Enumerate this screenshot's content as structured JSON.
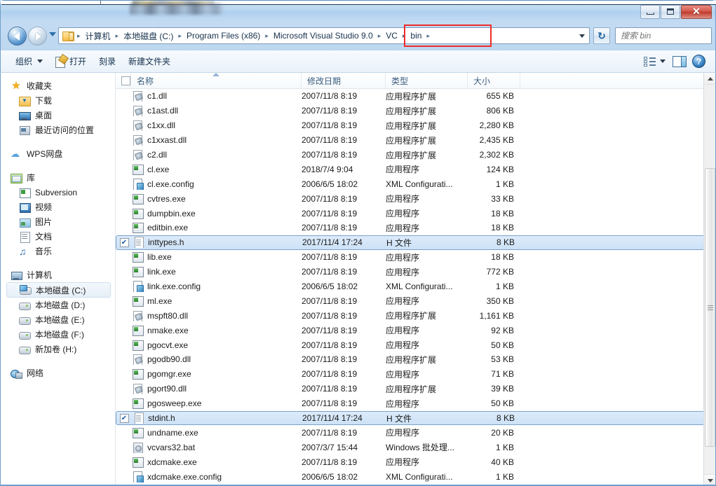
{
  "window": {
    "title_obscured": "",
    "controls": {
      "minimize": "最小化",
      "maximize": "最大化",
      "close": "✕"
    }
  },
  "navigation": {
    "back": "后退",
    "forward": "前进",
    "recent_dropdown": "最近浏览的位置",
    "refresh": "↻",
    "breadcrumbs": [
      {
        "label": "计算机",
        "highlighted": false
      },
      {
        "label": "本地磁盘 (C:)",
        "highlighted": false
      },
      {
        "label": "Program Files (x86)",
        "highlighted": false
      },
      {
        "label": "Microsoft Visual Studio 9.0",
        "highlighted": false
      },
      {
        "label": "VC",
        "highlighted": true
      },
      {
        "label": "bin",
        "highlighted": true
      }
    ],
    "separator": "▸",
    "highlight_color": "#ef2b2b"
  },
  "search": {
    "placeholder": "搜索 bin",
    "value": "",
    "icon": "search-icon"
  },
  "toolbar": {
    "organize_label": "组织",
    "open_label": "打开",
    "burn_label": "刻录",
    "new_folder_label": "新建文件夹",
    "view_options": "更改您的视图",
    "preview_pane": "显示预览窗格",
    "help": "?"
  },
  "sidebar": {
    "groups": [
      {
        "header": {
          "label": "收藏夹",
          "icon": "star-icon"
        },
        "items": [
          {
            "label": "下载",
            "icon": "downloads-folder-icon",
            "selected": false
          },
          {
            "label": "桌面",
            "icon": "desktop-icon",
            "selected": false
          },
          {
            "label": "最近访问的位置",
            "icon": "recent-places-icon",
            "selected": false
          }
        ]
      },
      {
        "header": {
          "label": "WPS网盘",
          "icon": "cloud-icon"
        },
        "items": []
      },
      {
        "header": {
          "label": "库",
          "icon": "library-icon"
        },
        "items": [
          {
            "label": "Subversion",
            "icon": "subversion-icon",
            "selected": false
          },
          {
            "label": "视频",
            "icon": "video-icon",
            "selected": false
          },
          {
            "label": "图片",
            "icon": "picture-icon",
            "selected": false
          },
          {
            "label": "文档",
            "icon": "document-icon",
            "selected": false
          },
          {
            "label": "音乐",
            "icon": "music-icon",
            "selected": false
          }
        ]
      },
      {
        "header": {
          "label": "计算机",
          "icon": "computer-icon"
        },
        "items": [
          {
            "label": "本地磁盘 (C:)",
            "icon": "system-drive-icon",
            "selected": true
          },
          {
            "label": "本地磁盘 (D:)",
            "icon": "drive-icon",
            "selected": false
          },
          {
            "label": "本地磁盘 (E:)",
            "icon": "drive-icon",
            "selected": false
          },
          {
            "label": "本地磁盘 (F:)",
            "icon": "drive-icon",
            "selected": false
          },
          {
            "label": "新加卷 (H:)",
            "icon": "drive-icon",
            "selected": false
          }
        ]
      },
      {
        "header": {
          "label": "网络",
          "icon": "network-icon"
        },
        "items": []
      }
    ]
  },
  "filelist": {
    "columns": [
      {
        "key": "name",
        "label": "名称",
        "sorted": true
      },
      {
        "key": "date",
        "label": "修改日期",
        "sorted": false
      },
      {
        "key": "type",
        "label": "类型",
        "sorted": false
      },
      {
        "key": "size",
        "label": "大小",
        "sorted": false
      }
    ],
    "rows": [
      {
        "name": "c1.dll",
        "date": "2007/11/8 8:19",
        "type": "应用程序扩展",
        "size": "655 KB",
        "icon": "dll-file-icon",
        "selected": false,
        "checked": false
      },
      {
        "name": "c1ast.dll",
        "date": "2007/11/8 8:19",
        "type": "应用程序扩展",
        "size": "806 KB",
        "icon": "dll-file-icon",
        "selected": false,
        "checked": false
      },
      {
        "name": "c1xx.dll",
        "date": "2007/11/8 8:19",
        "type": "应用程序扩展",
        "size": "2,280 KB",
        "icon": "dll-file-icon",
        "selected": false,
        "checked": false
      },
      {
        "name": "c1xxast.dll",
        "date": "2007/11/8 8:19",
        "type": "应用程序扩展",
        "size": "2,435 KB",
        "icon": "dll-file-icon",
        "selected": false,
        "checked": false
      },
      {
        "name": "c2.dll",
        "date": "2007/11/8 8:19",
        "type": "应用程序扩展",
        "size": "2,302 KB",
        "icon": "dll-file-icon",
        "selected": false,
        "checked": false
      },
      {
        "name": "cl.exe",
        "date": "2018/7/4 9:04",
        "type": "应用程序",
        "size": "124 KB",
        "icon": "exe-file-icon",
        "selected": false,
        "checked": false
      },
      {
        "name": "cl.exe.config",
        "date": "2006/6/5 18:02",
        "type": "XML Configurati...",
        "size": "1 KB",
        "icon": "xml-file-icon",
        "selected": false,
        "checked": false
      },
      {
        "name": "cvtres.exe",
        "date": "2007/11/8 8:19",
        "type": "应用程序",
        "size": "33 KB",
        "icon": "exe-file-icon",
        "selected": false,
        "checked": false
      },
      {
        "name": "dumpbin.exe",
        "date": "2007/11/8 8:19",
        "type": "应用程序",
        "size": "18 KB",
        "icon": "exe-file-icon",
        "selected": false,
        "checked": false
      },
      {
        "name": "editbin.exe",
        "date": "2007/11/8 8:19",
        "type": "应用程序",
        "size": "18 KB",
        "icon": "exe-file-icon",
        "selected": false,
        "checked": false
      },
      {
        "name": "inttypes.h",
        "date": "2017/11/4 17:24",
        "type": "H 文件",
        "size": "8 KB",
        "icon": "h-file-icon",
        "selected": true,
        "checked": true
      },
      {
        "name": "lib.exe",
        "date": "2007/11/8 8:19",
        "type": "应用程序",
        "size": "18 KB",
        "icon": "exe-file-icon",
        "selected": false,
        "checked": false
      },
      {
        "name": "link.exe",
        "date": "2007/11/8 8:19",
        "type": "应用程序",
        "size": "772 KB",
        "icon": "exe-file-icon",
        "selected": false,
        "checked": false
      },
      {
        "name": "link.exe.config",
        "date": "2006/6/5 18:02",
        "type": "XML Configurati...",
        "size": "1 KB",
        "icon": "xml-file-icon",
        "selected": false,
        "checked": false
      },
      {
        "name": "ml.exe",
        "date": "2007/11/8 8:19",
        "type": "应用程序",
        "size": "350 KB",
        "icon": "exe-file-icon",
        "selected": false,
        "checked": false
      },
      {
        "name": "mspft80.dll",
        "date": "2007/11/8 8:19",
        "type": "应用程序扩展",
        "size": "1,161 KB",
        "icon": "dll-file-icon",
        "selected": false,
        "checked": false
      },
      {
        "name": "nmake.exe",
        "date": "2007/11/8 8:19",
        "type": "应用程序",
        "size": "92 KB",
        "icon": "exe-file-icon",
        "selected": false,
        "checked": false
      },
      {
        "name": "pgocvt.exe",
        "date": "2007/11/8 8:19",
        "type": "应用程序",
        "size": "50 KB",
        "icon": "exe-file-icon",
        "selected": false,
        "checked": false
      },
      {
        "name": "pgodb90.dll",
        "date": "2007/11/8 8:19",
        "type": "应用程序扩展",
        "size": "53 KB",
        "icon": "dll-file-icon",
        "selected": false,
        "checked": false
      },
      {
        "name": "pgomgr.exe",
        "date": "2007/11/8 8:19",
        "type": "应用程序",
        "size": "71 KB",
        "icon": "exe-file-icon",
        "selected": false,
        "checked": false
      },
      {
        "name": "pgort90.dll",
        "date": "2007/11/8 8:19",
        "type": "应用程序扩展",
        "size": "39 KB",
        "icon": "dll-file-icon",
        "selected": false,
        "checked": false
      },
      {
        "name": "pgosweep.exe",
        "date": "2007/11/8 8:19",
        "type": "应用程序",
        "size": "50 KB",
        "icon": "exe-file-icon",
        "selected": false,
        "checked": false
      },
      {
        "name": "stdint.h",
        "date": "2017/11/4 17:24",
        "type": "H 文件",
        "size": "8 KB",
        "icon": "h-file-icon",
        "selected": true,
        "checked": true
      },
      {
        "name": "undname.exe",
        "date": "2007/11/8 8:19",
        "type": "应用程序",
        "size": "20 KB",
        "icon": "exe-file-icon",
        "selected": false,
        "checked": false
      },
      {
        "name": "vcvars32.bat",
        "date": "2007/3/7 15:44",
        "type": "Windows 批处理...",
        "size": "1 KB",
        "icon": "bat-file-icon",
        "selected": false,
        "checked": false
      },
      {
        "name": "xdcmake.exe",
        "date": "2007/11/8 8:19",
        "type": "应用程序",
        "size": "40 KB",
        "icon": "exe-file-icon",
        "selected": false,
        "checked": false
      },
      {
        "name": "xdcmake.exe.config",
        "date": "2006/6/5 18:02",
        "type": "XML Configurati...",
        "size": "1 KB",
        "icon": "xml-file-icon",
        "selected": false,
        "checked": false
      }
    ]
  },
  "scrollbar": {
    "up": "▲",
    "down": "▼"
  }
}
